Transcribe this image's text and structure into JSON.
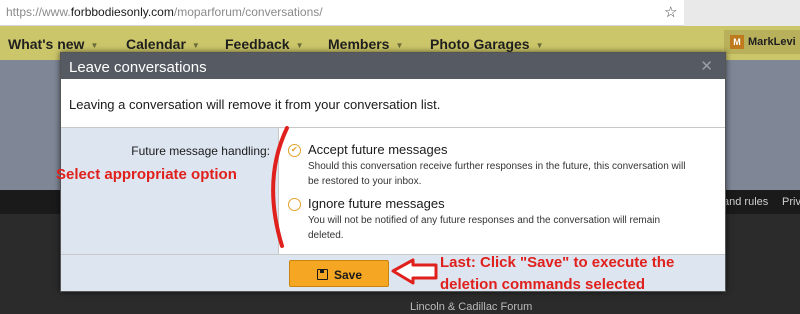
{
  "browser": {
    "url_scheme": "https://www.",
    "url_host": "forbbodiesonly.com",
    "url_path": "/moparforum/conversations/"
  },
  "nav": {
    "items": [
      "What's new",
      "Calendar",
      "Feedback",
      "Members",
      "Photo Garages"
    ],
    "user_initial": "M",
    "user_name": "MarkLevi"
  },
  "subnav": {
    "links": [
      "and rules",
      "Priv"
    ]
  },
  "background": {
    "forum_hint": "Lincoln & Cadillac Forum"
  },
  "dialog": {
    "title": "Leave conversations",
    "message": "Leaving a conversation will remove it from your conversation list.",
    "field_label": "Future message handling:",
    "options": [
      {
        "title": "Accept future messages",
        "desc1": "Should this conversation receive further responses in the future, this conversation will",
        "desc2": "be restored to your inbox.",
        "checked": true
      },
      {
        "title": "Ignore future messages",
        "desc1": "You will not be notified of any future responses and the conversation will remain",
        "desc2": "deleted.",
        "checked": false
      }
    ],
    "save_label": "Save"
  },
  "annotations": {
    "select": "Select appropriate option",
    "last_line1": "Last: Click \"Save\" to execute the",
    "last_line2": "deletion commands selected"
  },
  "colors": {
    "annotation": "#e0201c",
    "save_button": "#f5a623",
    "radio": "#e0a12a",
    "nav_bar": "#ccc66a",
    "dialog_header": "#555a63"
  },
  "icons": {
    "star": "star-icon",
    "close": "close-icon",
    "save": "floppy-disk-icon",
    "radio_check": "check-icon"
  }
}
